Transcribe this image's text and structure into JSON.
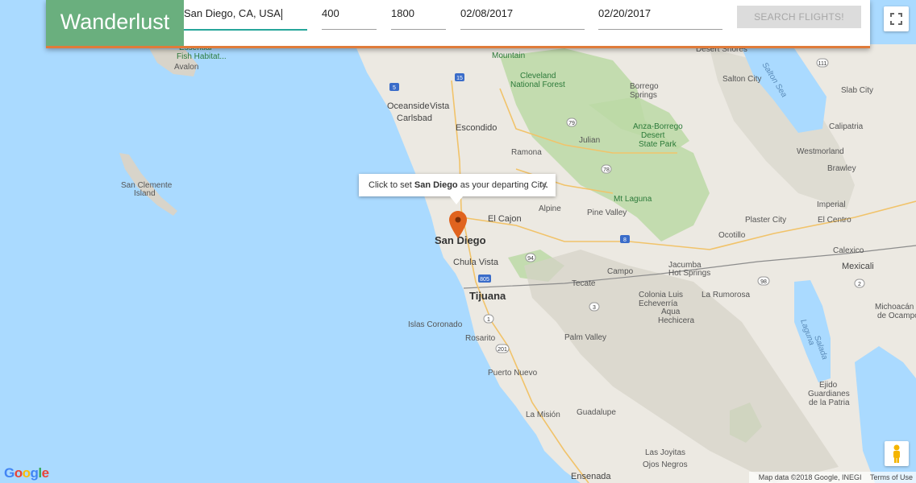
{
  "app": {
    "brand": "Wanderlust"
  },
  "search": {
    "city_value": "San Diego, CA, USA",
    "min_value": "400",
    "max_value": "1800",
    "depart_date": "02/08/2017",
    "return_date": "02/20/2017",
    "search_button": "SEARCH FLIGHTS!"
  },
  "infowindow": {
    "prefix": "Click to set ",
    "city": "San Diego",
    "suffix": " as your departing City.",
    "close": "✕"
  },
  "map": {
    "places": {
      "san_diego": "San Diego",
      "chula_vista": "Chula Vista",
      "tijuana": "Tijuana",
      "el_cajon": "El Cajon",
      "oceanside": "Oceanside",
      "vista": "Vista",
      "carlsbad": "Carlsbad",
      "escondido": "Escondido",
      "ramona": "Ramona",
      "julian": "Julian",
      "alpine": "Alpine",
      "pine_valley": "Pine Valley",
      "mt_laguna": "Mt Laguna",
      "campo": "Campo",
      "tecate": "Tecate",
      "jacumba": "Jacumba",
      "hot_springs": "Hot Springs",
      "colonia_luis": "Colonia Luis",
      "echeverria": "Echeverría",
      "la_rumorosa": "La Rumorosa",
      "aqua": "Aqua",
      "hechicera": "Hechicera",
      "palm_valley": "Palm Valley",
      "rosarito": "Rosarito",
      "puerto_nuevo": "Puerto Nuevo",
      "la_mision": "La Misión",
      "guadalupe": "Guadalupe",
      "ensenada": "Ensenada",
      "las_joyitas": "Las Joyitas",
      "ojos_negros": "Ojos Negros",
      "borrego_springs_1": "Borrego",
      "borrego_springs_2": "Springs",
      "anza_1": "Anza-Borrego",
      "anza_2": "Desert",
      "anza_3": "State Park",
      "cleveland_1": "Cleveland",
      "cleveland_2": "National Forest",
      "mountain": "Mountain",
      "salton_city": "Salton City",
      "salton_sea": "Salton Sea",
      "desert_shores": "Desert Shores",
      "slab_city": "Slab City",
      "calipatria": "Calipatria",
      "westmorland": "Westmorland",
      "brawley": "Brawley",
      "imperial": "Imperial",
      "plaster_city": "Plaster City",
      "el_centro": "El Centro",
      "ocotillo": "Ocotillo",
      "calexico": "Calexico",
      "mexicali": "Mexicali",
      "michoacan_1": "Michoacán",
      "michoacan_2": "de Ocampo",
      "laguna_salada_1": "Laguna",
      "laguna_salada_2": "Salada",
      "ejido_1": "Ejido",
      "ejido_2": "Guardianes",
      "ejido_3": "de la Patria",
      "islas_coronado": "Islas Coronado",
      "san_clemente_1": "San Clemente",
      "san_clemente_2": "Island",
      "avalon": "Avalon",
      "essential_1": "Essential",
      "essential_2": "Fish Habitat..."
    },
    "shields": [
      "15",
      "5",
      "79",
      "78",
      "67",
      "8",
      "805",
      "94",
      "3",
      "1",
      "201",
      "111",
      "98",
      "2"
    ]
  },
  "footer": {
    "google": "Google",
    "map_data": "Map data ©2018 Google, INEGI",
    "terms": "Terms of Use"
  },
  "colors": {
    "brand": "#6aaf7e",
    "accent_border": "#e07b3a",
    "active_input": "#26a69a",
    "water": "#aadaff",
    "pin": "#e0631e"
  }
}
